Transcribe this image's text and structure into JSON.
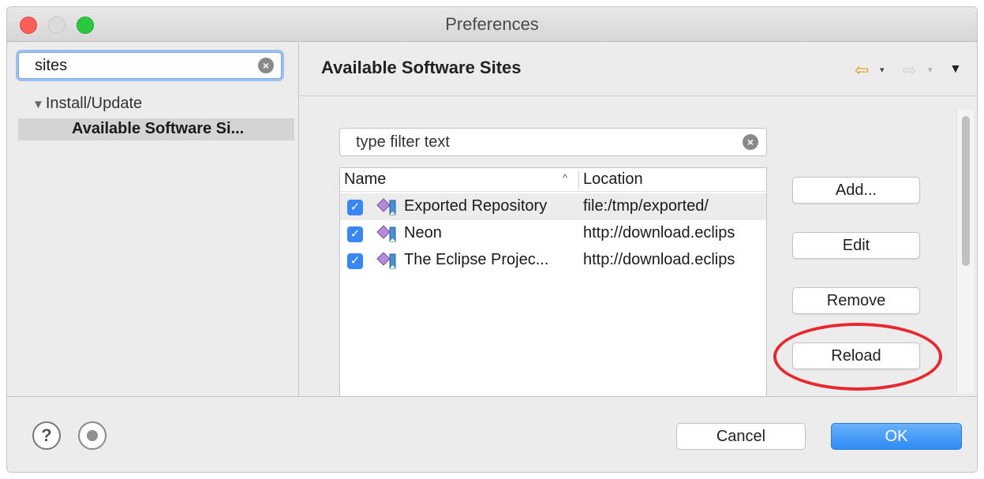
{
  "window": {
    "title": "Preferences"
  },
  "left": {
    "search_value": "sites",
    "tree": {
      "parent_label": "Install/Update",
      "selected_label": "Available Software Si..."
    }
  },
  "right": {
    "page_title": "Available Software Sites",
    "filter_placeholder": "type filter text",
    "table": {
      "columns": [
        "Name",
        "Location"
      ],
      "rows": [
        {
          "checked": true,
          "name": "Exported Repository",
          "location": "file:/tmp/exported/"
        },
        {
          "checked": true,
          "name": "Neon",
          "location": "http://download.eclips"
        },
        {
          "checked": true,
          "name": "The Eclipse Projec...",
          "location": "http://download.eclips"
        }
      ]
    },
    "buttons": {
      "add": "Add...",
      "edit": "Edit",
      "remove": "Remove",
      "reload": "Reload"
    }
  },
  "footer": {
    "cancel": "Cancel",
    "ok": "OK"
  },
  "icons": {
    "help": "?",
    "checkmark": "✓",
    "clear": "×",
    "back": "⇦",
    "forward": "⇨",
    "dropdown": "▾",
    "view_menu": "▼",
    "tree_expanded": "▼",
    "sort": "^"
  },
  "colors": {
    "accent": "#3b86f5",
    "highlight": "#e8282f",
    "close": "#fc5f57",
    "maximize": "#2ac840"
  }
}
